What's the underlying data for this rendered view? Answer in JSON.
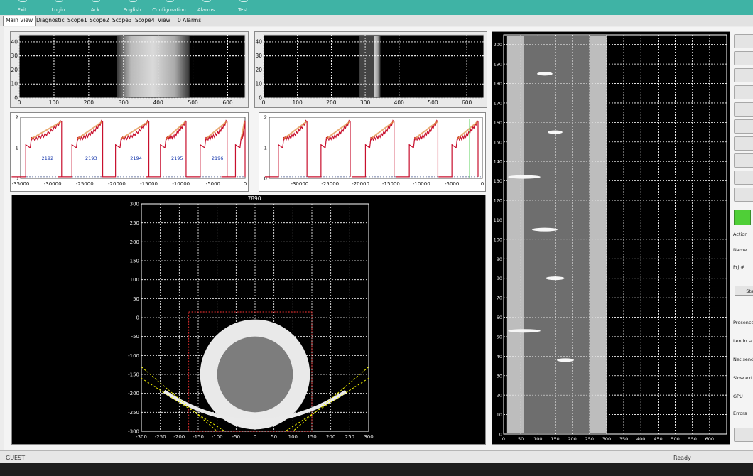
{
  "toolbar": {
    "items": [
      "Exit",
      "Login",
      "Ack",
      "English",
      "Configuration",
      "Alarms",
      "Test"
    ]
  },
  "tabs": [
    "Main View",
    "Diagnostic",
    "Scope1",
    "Scope2",
    "Scope3",
    "Scope4",
    "View"
  ],
  "alarms_label": "0 Alarms",
  "ct_title": "7890",
  "scope_labels": [
    "2192",
    "2193",
    "2194",
    "2195",
    "2196"
  ],
  "sidebar": {
    "labels": [
      "Action",
      "Name",
      "Prj #",
      "Sta",
      "Presence",
      "Len in sca",
      "Net send",
      "Slow extr",
      "GPU",
      "Errors"
    ],
    "led_color": "#4fcf37"
  },
  "status": {
    "left": "GUEST",
    "right": "Ready"
  },
  "colors": {
    "teal": "#3fb3a5",
    "trace": "#c8102e",
    "trace_fill": "#e08a3a",
    "grid": "#ffffff",
    "plot_bg": "#000000",
    "marker": "#ffff00"
  },
  "chart_data": [
    {
      "type": "image",
      "name": "sensor-1",
      "ylim": [
        0,
        45
      ],
      "xlim": [
        0,
        650
      ],
      "x_ticks": [
        0,
        100,
        200,
        300,
        400,
        500,
        600
      ],
      "y_ticks": [
        0,
        10,
        20,
        30,
        40
      ]
    },
    {
      "type": "image",
      "name": "sensor-2",
      "ylim": [
        0,
        45
      ],
      "xlim": [
        0,
        650
      ],
      "x_ticks": [
        0,
        100,
        200,
        300,
        400,
        500,
        600
      ],
      "y_ticks": [
        0,
        10,
        20,
        30,
        40
      ]
    },
    {
      "type": "line",
      "name": "scope-1",
      "xlim": [
        -35000,
        0
      ],
      "ylim": [
        0,
        2
      ],
      "x_ticks": [
        -35000,
        -30000,
        -25000,
        -20000,
        -15000,
        -10000,
        -5000,
        0
      ],
      "y_ticks": [
        0,
        1,
        2
      ]
    },
    {
      "type": "line",
      "name": "scope-2",
      "xlim": [
        -35000,
        0
      ],
      "ylim": [
        0,
        2
      ],
      "x_ticks": [
        -30000,
        -25000,
        -20000,
        -15000,
        -10000,
        -5000,
        0
      ],
      "y_ticks": [
        0,
        1,
        2
      ]
    },
    {
      "type": "image",
      "name": "ct-slice",
      "xlim": [
        -300,
        300
      ],
      "ylim": [
        -300,
        300
      ],
      "x_ticks": [
        -300,
        -250,
        -200,
        -150,
        -100,
        -50,
        0,
        50,
        100,
        150,
        200,
        250,
        300
      ],
      "y_ticks": [
        -300,
        -250,
        -200,
        -150,
        -100,
        -50,
        0,
        50,
        100,
        150,
        200,
        250,
        300
      ]
    },
    {
      "type": "image",
      "name": "longitudinal-scan",
      "xlim": [
        0,
        650
      ],
      "ylim": [
        0,
        205
      ],
      "x_ticks": [
        0,
        50,
        100,
        150,
        200,
        250,
        300,
        350,
        400,
        450,
        500,
        550,
        600
      ],
      "y_ticks": [
        0,
        10,
        20,
        30,
        40,
        50,
        60,
        70,
        80,
        90,
        100,
        110,
        120,
        130,
        140,
        150,
        160,
        170,
        180,
        190,
        200
      ]
    }
  ]
}
